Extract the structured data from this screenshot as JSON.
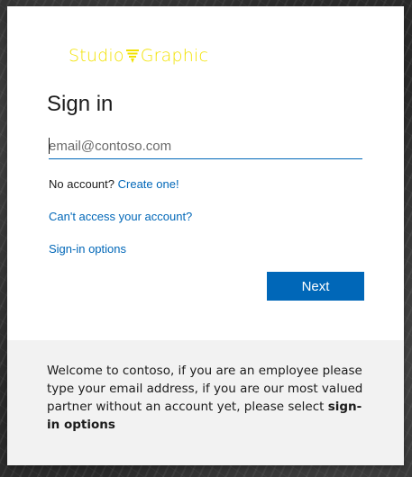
{
  "brand": {
    "name_left": "Studio",
    "name_right": "Graphic",
    "logo_icon": "funnel-glass-icon",
    "color": "#f2e200"
  },
  "signin": {
    "title": "Sign in",
    "email_placeholder": "email@contoso.com",
    "email_value": "",
    "no_account_text": "No account?",
    "create_link": "Create one!",
    "cant_access_link": "Can't access your account?",
    "signin_options_link": "Sign-in options",
    "next_label": "Next",
    "accent_color": "#0067b8"
  },
  "footer": {
    "message_prefix": "Welcome to contoso, if you are an employee please type your email address, if you are our most valued partner without an account yet, please select ",
    "message_bold": "sign-in options"
  }
}
